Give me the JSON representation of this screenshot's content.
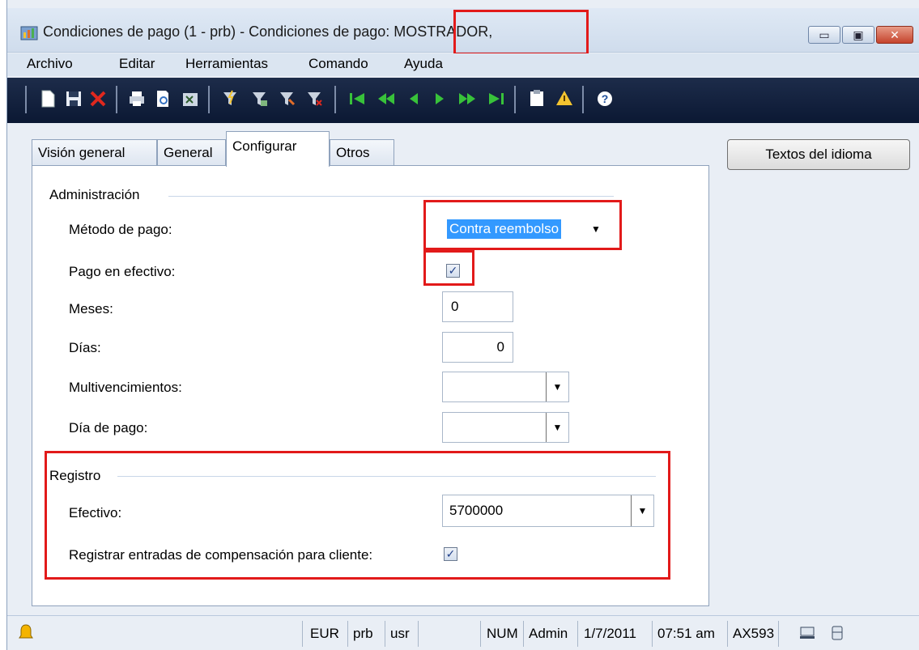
{
  "window": {
    "title_prefix": "Condiciones de pago (1 - prb) - Condiciones de pago: ",
    "title_record": "MOSTRADOR,",
    "min_glyph": "▭",
    "max_glyph": "▣",
    "close_glyph": "✕"
  },
  "menu": [
    "Archivo",
    "Editar",
    "Herramientas",
    "Comando",
    "Ayuda"
  ],
  "toolbar_icons": [
    "new-icon",
    "save-icon",
    "delete-icon",
    "print-icon",
    "print-preview-icon",
    "export-icon",
    "filter-by-selection-icon",
    "filter-by-grid-icon",
    "advanced-filter-icon",
    "remove-filter-icon",
    "first-record-icon",
    "previous-page-icon",
    "previous-record-icon",
    "next-record-icon",
    "next-page-icon",
    "last-record-icon",
    "attachments-icon",
    "alert-icon",
    "help-icon"
  ],
  "tabs": [
    "Visión general",
    "General",
    "Configurar",
    "Otros"
  ],
  "language_texts_button": "Textos del idioma",
  "administracion": {
    "title": "Administración",
    "metodo_label": "Método de pago:",
    "metodo_value": "Contra reembolso",
    "pago_efectivo_label": "Pago en efectivo:",
    "pago_efectivo_checked": true,
    "meses_label": "Meses:",
    "meses_value": "0",
    "dias_label": "Días:",
    "dias_value": "0",
    "multivenc_label": "Multivencimientos:",
    "multivenc_value": "",
    "dia_pago_label": "Día de pago:",
    "dia_pago_value": ""
  },
  "registro": {
    "title": "Registro",
    "efectivo_label": "Efectivo:",
    "efectivo_value": "5700000",
    "compensacion_label": "Registrar entradas de compensación para cliente:",
    "compensacion_checked": true
  },
  "statusbar": {
    "currency": "EUR",
    "company": "prb",
    "layer": "usr",
    "num": "NUM",
    "user": "Admin",
    "date": "1/7/2011",
    "time": "07:51 am",
    "server": "AX593"
  },
  "colors": {
    "highlight": "#e21a1a",
    "toolbar_bg": "#0b1833",
    "selection": "#3399ff"
  }
}
